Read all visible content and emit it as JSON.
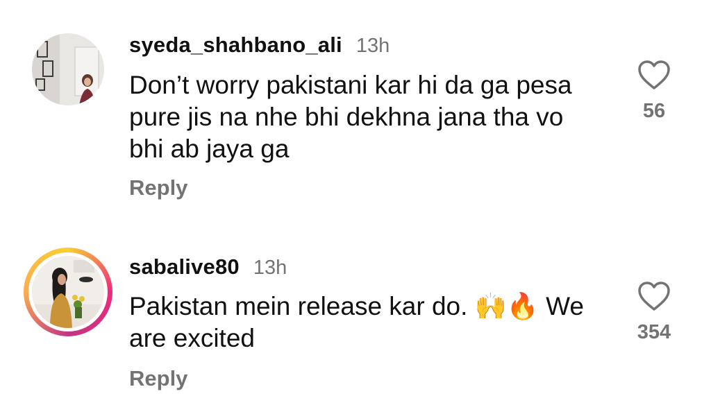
{
  "comments": [
    {
      "username": "syeda_shahbano_ali",
      "time": "13h",
      "text": "Don’t worry pakistani kar hi da ga pesa pure jis na nhe bhi dekhna jana tha vo bhi ab jaya ga",
      "likes": "56",
      "reply_label": "Reply",
      "avatar_ring": false
    },
    {
      "username": "sabalive80",
      "time": "13h",
      "text": "Pakistan mein release kar do. 🙌🔥 We are excited",
      "likes": "354",
      "reply_label": "Reply",
      "avatar_ring": true
    }
  ],
  "icons": {
    "like": "heart-outline-icon"
  },
  "colors": {
    "secondary_text": "#737373",
    "primary_text": "#111111",
    "story_ring": "#ee2a7b"
  }
}
